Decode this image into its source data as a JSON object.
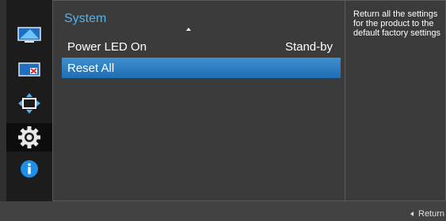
{
  "sidebar": {
    "items": [
      {
        "icon": "picture-monitor-icon"
      },
      {
        "icon": "screen-adjust-icon"
      },
      {
        "icon": "onscreen-display-move-icon"
      },
      {
        "icon": "system-gear-icon"
      },
      {
        "icon": "information-icon"
      }
    ],
    "active_index": 3
  },
  "menu": {
    "title": "System",
    "items": [
      {
        "label": "Power LED On",
        "value": "Stand-by"
      },
      {
        "label": "Reset All",
        "value": ""
      }
    ],
    "selected_index": 1
  },
  "description": {
    "text": "Return all the settings\nfor the product to the\ndefault factory settings"
  },
  "footer": {
    "return_label": "Return"
  },
  "colors": {
    "accent": "#4fb3f0",
    "selected_row": "#2a7dc4"
  }
}
